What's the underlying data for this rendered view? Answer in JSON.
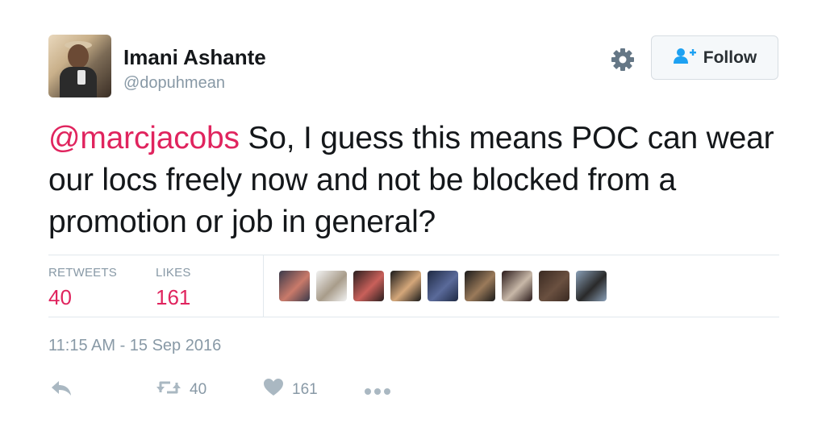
{
  "user": {
    "name": "Imani Ashante",
    "handle": "@dopuhmean"
  },
  "header": {
    "follow_label": "Follow",
    "settings_icon": "gear-icon",
    "follow_icon": "follow-person-plus-icon"
  },
  "tweet": {
    "mention": "@marcjacobs",
    "text": " So, I guess this means POC can wear our locs freely now and not be blocked from a promotion or job in general?",
    "timestamp": "11:15 AM - 15 Sep 2016"
  },
  "stats": {
    "retweets_label": "RETWEETS",
    "retweets": "40",
    "likes_label": "LIKES",
    "likes": "161"
  },
  "likers": [
    {
      "name": "liker-1",
      "colors": [
        "#3a3a4a",
        "#c97a6a"
      ]
    },
    {
      "name": "liker-2",
      "colors": [
        "#f2f2f2",
        "#a89c8a"
      ]
    },
    {
      "name": "liker-3",
      "colors": [
        "#2a1f1f",
        "#c9605a"
      ]
    },
    {
      "name": "liker-4",
      "colors": [
        "#1a1a1a",
        "#d4a77a"
      ]
    },
    {
      "name": "liker-5",
      "colors": [
        "#1f2a44",
        "#5a6a9a"
      ]
    },
    {
      "name": "liker-6",
      "colors": [
        "#1a1a1a",
        "#9a7a5a"
      ]
    },
    {
      "name": "liker-7",
      "colors": [
        "#2a1a1a",
        "#c8b8a8"
      ]
    },
    {
      "name": "liker-8",
      "colors": [
        "#3a2a22",
        "#6a5040"
      ]
    },
    {
      "name": "liker-9",
      "colors": [
        "#8aa0b8",
        "#2a2a2a"
      ]
    }
  ],
  "actions": {
    "reply_icon": "reply-icon",
    "retweet_icon": "retweet-icon",
    "retweet_count": "40",
    "like_icon": "heart-icon",
    "like_count": "161",
    "more_icon": "more-dots-icon"
  },
  "colors": {
    "accent": "#e0245e",
    "muted": "#8899a6",
    "text": "#14171a",
    "divider": "#e1e8ed",
    "follow_icon": "#1da1f2"
  }
}
